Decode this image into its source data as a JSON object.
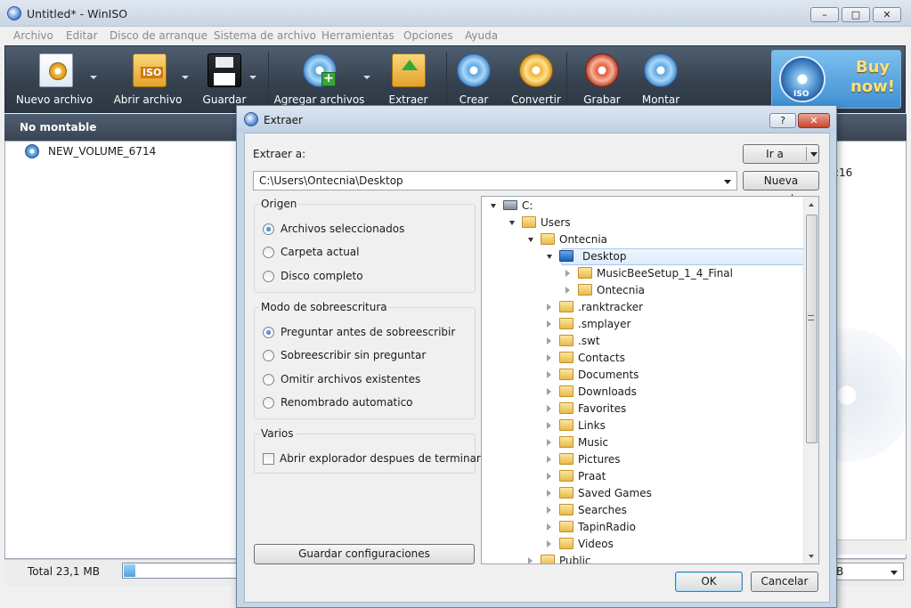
{
  "window": {
    "title": "Untitled* - WinISO",
    "controls": {
      "minimize": "–",
      "maximize": "□",
      "close": "✕"
    }
  },
  "menu": [
    "Archivo",
    "Editar",
    "Disco de arranque",
    "Sistema de archivo",
    "Herramientas",
    "Opciones",
    "Ayuda"
  ],
  "toolbar": {
    "new_file": "Nuevo archivo",
    "open_file": "Abrir archivo",
    "save": "Guardar",
    "add_files": "Agregar archivos",
    "extract": "Extraer",
    "create": "Crear",
    "convert": "Convertir",
    "burn": "Grabar",
    "mount": "Montar",
    "buy_now": "Buy now!",
    "buy_badge": "ISO",
    "new_badge": "ISO"
  },
  "left_panel": {
    "header": "No montable",
    "root_item": "NEW_VOLUME_6714",
    "root_icon_text": "ISO"
  },
  "right_panel": {
    "time_fragment": ":16"
  },
  "statusbar": {
    "total": "Total 23,1 MB",
    "progress": 0.1,
    "right_select": "B"
  },
  "dialog": {
    "title": "Extraer",
    "help": "?",
    "close": "✕",
    "extract_to_label": "Extraer a:",
    "goto_button": "Ir a",
    "path": "C:\\Users\\Ontecnia\\Desktop",
    "new_folder_button": "Nueva carpeta",
    "origin": {
      "title": "Origen",
      "options": [
        "Archivos seleccionados",
        "Carpeta actual",
        "Disco completo"
      ],
      "selected": 0
    },
    "overwrite": {
      "title": "Modo de sobreescritura",
      "options": [
        "Preguntar antes de sobreescribir",
        "Sobreescribir sin preguntar",
        "Omitir archivos existentes",
        "Renombrado automatico"
      ],
      "selected": 0
    },
    "misc": {
      "title": "Varios",
      "open_explorer": "Abrir explorador despues de terminar",
      "open_explorer_checked": false
    },
    "save_settings_button": "Guardar configuraciones",
    "ok_button": "OK",
    "cancel_button": "Cancelar",
    "tree": [
      {
        "label": "C:",
        "level": 0,
        "expanded": true,
        "icon": "drive-icon"
      },
      {
        "label": "Users",
        "level": 1,
        "expanded": true,
        "icon": "folder-icon"
      },
      {
        "label": "Ontecnia",
        "level": 2,
        "expanded": true,
        "icon": "user-folder-icon"
      },
      {
        "label": "Desktop",
        "level": 3,
        "expanded": true,
        "icon": "desktop-icon",
        "selected": true
      },
      {
        "label": "MusicBeeSetup_1_4_Final",
        "level": 4,
        "expanded": false,
        "icon": "folder-icon"
      },
      {
        "label": "Ontecnia",
        "level": 4,
        "expanded": false,
        "icon": "shortcut-folder-icon"
      },
      {
        "label": ".ranktracker",
        "level": 3,
        "expanded": false,
        "icon": "folder-icon"
      },
      {
        "label": ".smplayer",
        "level": 3,
        "expanded": false,
        "icon": "folder-icon"
      },
      {
        "label": ".swt",
        "level": 3,
        "expanded": false,
        "icon": "folder-icon"
      },
      {
        "label": "Contacts",
        "level": 3,
        "expanded": false,
        "icon": "contacts-folder-icon"
      },
      {
        "label": "Documents",
        "level": 3,
        "expanded": false,
        "icon": "documents-folder-icon"
      },
      {
        "label": "Downloads",
        "level": 3,
        "expanded": false,
        "icon": "downloads-folder-icon"
      },
      {
        "label": "Favorites",
        "level": 3,
        "expanded": false,
        "icon": "favorites-folder-icon"
      },
      {
        "label": "Links",
        "level": 3,
        "expanded": false,
        "icon": "links-folder-icon"
      },
      {
        "label": "Music",
        "level": 3,
        "expanded": false,
        "icon": "music-folder-icon"
      },
      {
        "label": "Pictures",
        "level": 3,
        "expanded": false,
        "icon": "pictures-folder-icon"
      },
      {
        "label": "Praat",
        "level": 3,
        "expanded": false,
        "icon": "folder-icon"
      },
      {
        "label": "Saved Games",
        "level": 3,
        "expanded": false,
        "icon": "saved-games-folder-icon"
      },
      {
        "label": "Searches",
        "level": 3,
        "expanded": false,
        "icon": "searches-folder-icon"
      },
      {
        "label": "TapinRadio",
        "level": 3,
        "expanded": false,
        "icon": "folder-icon"
      },
      {
        "label": "Videos",
        "level": 3,
        "expanded": false,
        "icon": "videos-folder-icon"
      },
      {
        "label": "Public",
        "level": 2,
        "expanded": false,
        "icon": "folder-icon"
      }
    ]
  }
}
